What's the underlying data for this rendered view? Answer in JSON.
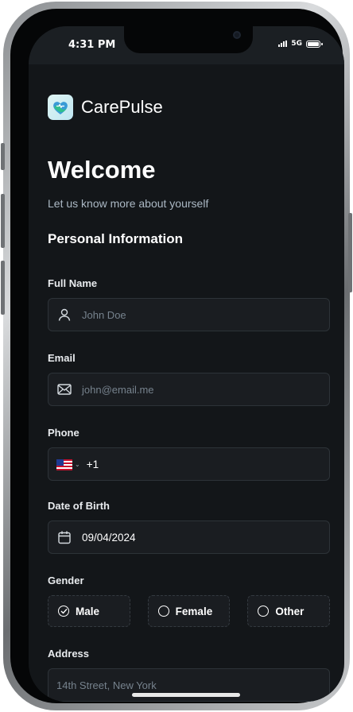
{
  "status_bar": {
    "time": "4:31 PM",
    "network": "5G"
  },
  "app": {
    "brand": "CarePulse"
  },
  "header": {
    "title": "Welcome",
    "subtitle": "Let us know more about yourself"
  },
  "section_title": "Personal Information",
  "form": {
    "full_name": {
      "label": "Full Name",
      "placeholder": "John Doe",
      "icon": "user-icon"
    },
    "email": {
      "label": "Email",
      "placeholder": "john@email.me",
      "icon": "mail-icon"
    },
    "phone": {
      "label": "Phone",
      "value": "+1",
      "country": "US"
    },
    "date_of_birth": {
      "label": "Date of Birth",
      "value": "09/04/2024",
      "icon": "calendar-icon"
    },
    "gender": {
      "label": "Gender",
      "options": [
        "Male",
        "Female",
        "Other"
      ],
      "selected": "Male"
    },
    "address": {
      "label": "Address",
      "placeholder": "14th Street, New York"
    }
  },
  "colors": {
    "background": "#131619",
    "field": "#1a1d21",
    "border": "#2d3338",
    "accent": "#24ae7c"
  }
}
